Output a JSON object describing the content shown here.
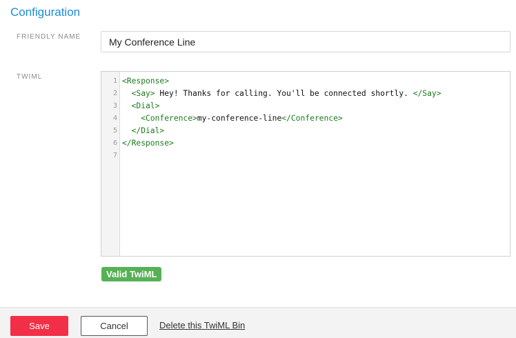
{
  "section": {
    "title": "Configuration"
  },
  "fields": {
    "friendly_name": {
      "label": "FRIENDLY NAME",
      "value": "My Conference Line"
    },
    "twiml": {
      "label": "TWIML"
    }
  },
  "editor": {
    "lines": [
      {
        "num": "1",
        "parts": [
          {
            "t": "<Response>",
            "tag": true
          }
        ]
      },
      {
        "num": "2",
        "parts": [
          {
            "t": "  <Say>",
            "tag": true
          },
          {
            "t": " Hey! Thanks for calling. You'll be connected shortly. ",
            "tag": false
          },
          {
            "t": "</Say>",
            "tag": true
          }
        ]
      },
      {
        "num": "3",
        "parts": [
          {
            "t": "  <Dial>",
            "tag": true
          }
        ]
      },
      {
        "num": "4",
        "parts": [
          {
            "t": "    <Conference>",
            "tag": true
          },
          {
            "t": "my-conference-line",
            "tag": false
          },
          {
            "t": "</Conference>",
            "tag": true
          }
        ]
      },
      {
        "num": "5",
        "parts": [
          {
            "t": "  </Dial>",
            "tag": true
          }
        ]
      },
      {
        "num": "6",
        "parts": [
          {
            "t": "</Response>",
            "tag": true
          }
        ]
      },
      {
        "num": "7",
        "parts": []
      }
    ]
  },
  "validation": {
    "label": "Valid TwiML",
    "color": "#56b155"
  },
  "footer": {
    "save_label": "Save",
    "cancel_label": "Cancel",
    "delete_label": "Delete this TwiML Bin"
  },
  "colors": {
    "accent": "#1a8cdb",
    "save": "#f22f46",
    "xml_tag": "#1c7a1c"
  }
}
